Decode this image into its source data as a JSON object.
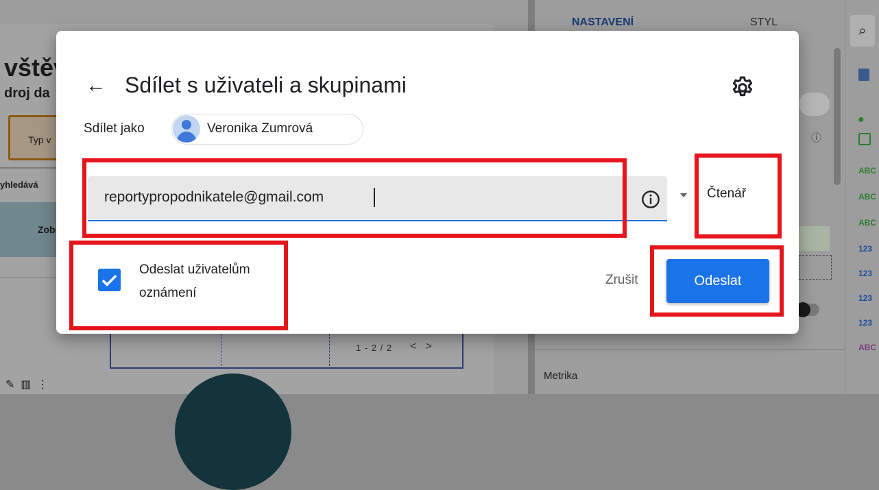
{
  "background": {
    "title_fragment": "vštěv",
    "subtitle_fragment": "droj da",
    "filter_fragment": "Typ v",
    "search_fragment": "yhledává",
    "show_fragment": "Zobr",
    "pagination": "1 - 2 / 2",
    "panel_tabs": {
      "setup": "NASTAVENÍ",
      "style": "STYL"
    },
    "metric_label": "Metrika",
    "rail_items": [
      "ABC",
      "ABC",
      "ABC",
      "123",
      "123",
      "123",
      "123",
      "ABC"
    ]
  },
  "dialog": {
    "title": "Sdílet s uživateli a skupinami",
    "share_as_label": "Sdílet jako",
    "owner_name": "Veronika Zumrová",
    "email_value": "reportypropodnikatele@gmail.com",
    "role": "Čtenář",
    "notify_line1": "Odeslat uživatelům",
    "notify_line2": "oznámení",
    "notify_checked": true,
    "cancel_label": "Zrušit",
    "send_label": "Odeslat"
  },
  "colors": {
    "primary": "#1a73e8",
    "highlight": "#e4161b"
  }
}
